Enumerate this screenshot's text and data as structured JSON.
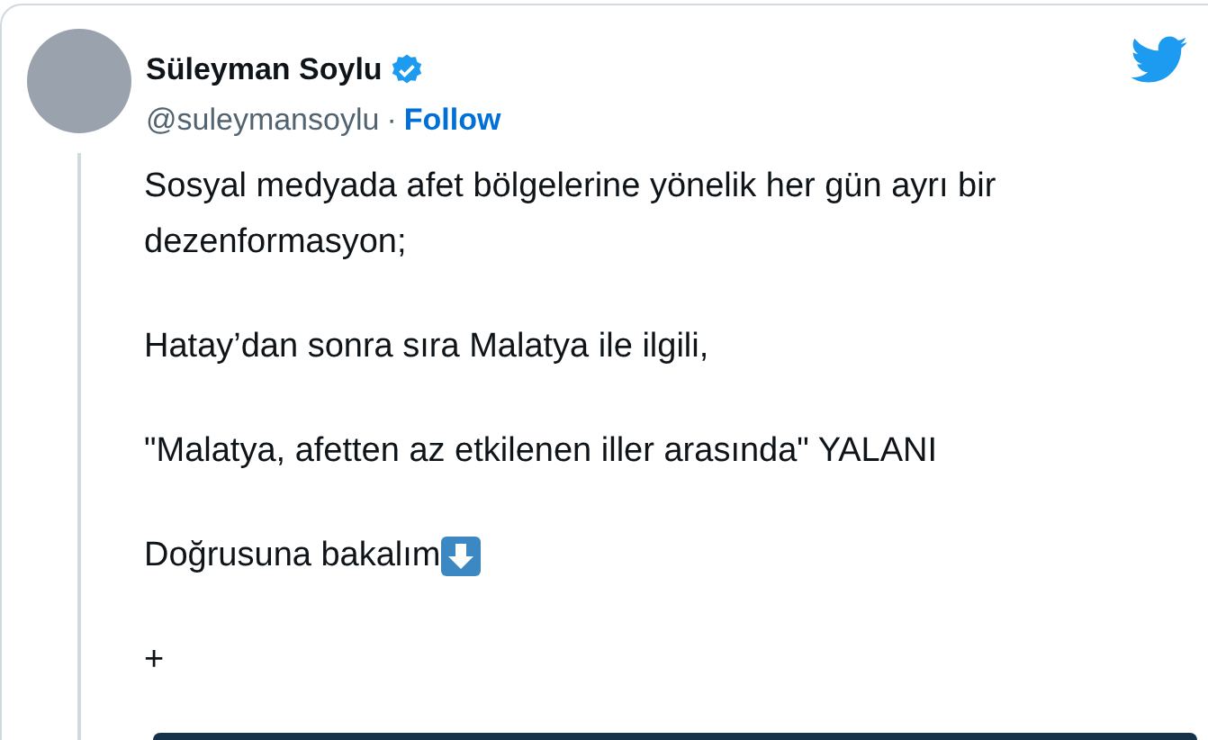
{
  "author": {
    "name": "Süleyman Soylu",
    "verified": true,
    "handle": "@suleymansoylu",
    "separator": "·",
    "follow": "Follow"
  },
  "paragraphs": [
    {
      "text": "Sosyal medyada afet bölgelerine yönelik her gün ayrı bir dezenformasyon;"
    },
    {
      "text": "Hatay’dan sonra sıra Malatya ile ilgili,"
    },
    {
      "text": "\"Malatya, afetten az etkilenen iller arasında\" YALANI"
    },
    {
      "text": "Doğrusuna bakalım",
      "kind": "with-arrow-emoji"
    },
    {
      "text": "+"
    }
  ]
}
